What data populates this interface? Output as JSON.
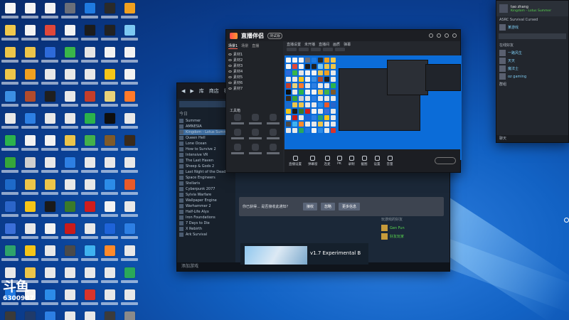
{
  "desktop": {
    "icon_colors": [
      "#f5f5f5",
      "#f3f3f3",
      "#f2f2f2",
      "#6a6f7a",
      "#1f7ae0",
      "#2a2a2a",
      "#f0a020",
      "#f2c94c",
      "#f3f3f3",
      "#e0473a",
      "#f3f3f3",
      "#1c1c1c",
      "#222222",
      "#7cc8f2",
      "#ecc54a",
      "#ecc54a",
      "#2d6ad9",
      "#39b54a",
      "#e5e5e5",
      "#f2f2f2",
      "#f2f2f2",
      "#ecc54a",
      "#f0a020",
      "#e8e8e8",
      "#e8e8e8",
      "#e8e8e8",
      "#f5c518",
      "#f2f2f2",
      "#3c8fe3",
      "#b04b2c",
      "#1f1f1f",
      "#e8e8e8",
      "#c43e2a",
      "#e9d27a",
      "#ff7a2a",
      "#e8e8e8",
      "#2d7fe3",
      "#e8e8e8",
      "#e8e8e8",
      "#2bb24c",
      "#0f0f0f",
      "#e8e8e8",
      "#2bb24c",
      "#f2f2f2",
      "#f2f2f2",
      "#ecc54a",
      "#43b14b",
      "#7f5a2a",
      "#3a2a1a",
      "#35a63a",
      "#cfcfcf",
      "#e8e8e8",
      "#2d7fe3",
      "#e8e8e8",
      "#e8e8e8",
      "#e8e8e8",
      "#1e6ac9",
      "#ecc54a",
      "#ecc54a",
      "#e8e8e8",
      "#e8e8e8",
      "#2c8ce8",
      "#e85a2a",
      "#2b65c9",
      "#f5c518",
      "#1a1a1a",
      "#3a7a2a",
      "#cf1d1d",
      "#f2f2f2",
      "#e8e8e8",
      "#3b6fd8",
      "#e8e8e8",
      "#f2f2f2",
      "#c91b1b",
      "#e8e8e8",
      "#1e63d8",
      "#2d7fe3",
      "#2ea36b",
      "#f5c518",
      "#e8e8e8",
      "#4a4a4a",
      "#3fb2f0",
      "#ff8a2a",
      "#e8e8e8",
      "#e8e8e8",
      "#ecc54a",
      "#e8e8e8",
      "#e8e8e8",
      "#e8e8e8",
      "#e8e8e8",
      "#2aa85a",
      "#1f78e0",
      "#f2f2f2",
      "#2c8ce8",
      "#e8e8e8",
      "#d9342b",
      "#e8e8e8",
      "#e8e8e8",
      "#3a3a3a",
      "#1f3a6a",
      "#2d7fe3",
      "#e8e8e8",
      "#e8e8e8",
      "#3b3b3b",
      "#8a8a8a"
    ]
  },
  "watermark": {
    "logo": "斗鱼",
    "number": "6300987"
  },
  "steam": {
    "nav": [
      "库",
      "商店",
      "社区"
    ],
    "side_group_recent": "今日",
    "side_group_played": "本周",
    "games": [
      {
        "name": "Summer",
        "sel": false
      },
      {
        "name": "AMNESIA",
        "sel": false
      },
      {
        "name": "Kingdom - Lotus Summer",
        "sel": true
      },
      {
        "name": "Queen Hell",
        "sel": false
      },
      {
        "name": "Lone Ocean",
        "sel": false
      },
      {
        "name": "How to Survive 2",
        "sel": false
      },
      {
        "name": "Intensive VR",
        "sel": false
      },
      {
        "name": "The Last Haven",
        "sel": false
      },
      {
        "name": "Sheep & Gods 2",
        "sel": false
      },
      {
        "name": "Last Night of the Dead",
        "sel": false
      },
      {
        "name": "Space Engineers",
        "sel": false
      },
      {
        "name": "Stellaris",
        "sel": false
      },
      {
        "name": "Cyberpunk 2077",
        "sel": false
      },
      {
        "name": "Sylvia Warfare",
        "sel": false
      },
      {
        "name": "Wallpaper Engine",
        "sel": false
      },
      {
        "name": "Warhammer 2",
        "sel": false
      },
      {
        "name": "Half-Life Alyx",
        "sel": false
      },
      {
        "name": "Iron Foundations",
        "sel": false
      },
      {
        "name": "7 Days to Die",
        "sel": false
      },
      {
        "name": "X Rebirth",
        "sel": false
      },
      {
        "name": "Ark Survival",
        "sel": false
      }
    ],
    "bottom_label": "添加游戏",
    "update_title": "v1.7 Experimental B"
  },
  "helper": {
    "brand": "直播伴侣",
    "badge": "测试版",
    "tabs": [
      "场景1",
      "场景",
      "直播"
    ],
    "scenes": [
      "素材1",
      "素材2",
      "素材3",
      "素材4",
      "素材5",
      "素材6",
      "素材7"
    ],
    "tools_title": "工具箱",
    "live_bar": [
      "直播设置",
      "未开播",
      "直播间",
      "画质",
      "弹幕"
    ],
    "bottom_buttons": [
      "直播设置",
      "弹幕窗",
      "连麦",
      "PK",
      "录制",
      "截图",
      "设置",
      "音量"
    ]
  },
  "chat": {
    "text": "你已获得... 是否接收此通知?",
    "buttons": [
      "接收",
      "忽略",
      "更多信息"
    ]
  },
  "friend_panel": {
    "title": "玩游戏的好友",
    "rows": [
      "Gen Fun",
      "好友玩家"
    ]
  },
  "friends": {
    "user": "tao zhang",
    "status": "Kingdom - Lotus Summer",
    "playing_user": "ASRC Survival Cursed",
    "playing_game": "某游戏",
    "section_online": "在线好友",
    "friends": [
      "一路风生",
      "天天",
      "魔法士",
      "oz gaming"
    ],
    "section_group": "群组",
    "footer": "聊天"
  }
}
